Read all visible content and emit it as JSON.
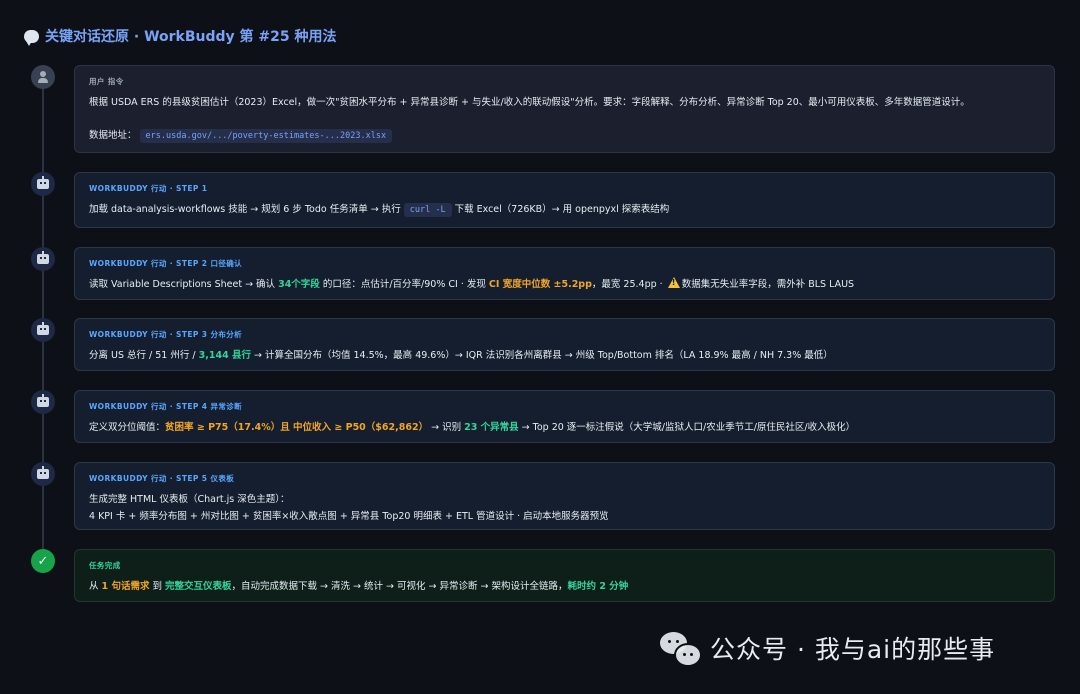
{
  "title": "关键对话还原 · WorkBuddy 第 #25 种用法",
  "cards": [
    {
      "label": "用户 指令",
      "line1": "根据 USDA ERS 的县级贫困估计（2023）Excel，做一次\"贫困水平分布 + 异常县诊断 + 与失业/收入的联动假设\"分析。要求：字段解释、分布分析、异常诊断 Top 20、最小可用仪表板、多年数据管道设计。",
      "line2_prefix": "数据地址：",
      "line2_code": "ers.usda.gov/.../poverty-estimates-...2023.xlsx"
    },
    {
      "label": "WORKBUDDY 行动 · STEP 1",
      "text_a": "加载 data-analysis-workflows 技能 → 规划 6 步 Todo 任务清单 → 执行 ",
      "code": "curl -L",
      "text_b": " 下载 Excel（726KB）→ 用 openpyxl 探索表结构"
    },
    {
      "label": "WORKBUDDY 行动 · STEP 2 口径确认",
      "text_a": "读取 Variable Descriptions Sheet → 确认 ",
      "hl_a": "34个字段",
      "text_b": " 的口径：点估计/百分率/90% CI · 发现 ",
      "hl_b": "CI 宽度中位数 ±5.2pp",
      "text_c": "，最宽 25.4pp · ",
      "text_d": "数据集无失业率字段，需外补 BLS LAUS"
    },
    {
      "label": "WORKBUDDY 行动 · STEP 3 分布分析",
      "text_a": "分离 US 总行 / 51 州行 / ",
      "hl_a": "3,144 县行",
      "text_b": " → 计算全国分布（均值 14.5%，最高 49.6%）→ IQR 法识别各州离群县 → 州级 Top/Bottom 排名（LA 18.9% 最高 / NH 7.3% 最低）"
    },
    {
      "label": "WORKBUDDY 行动 · STEP 4 异常诊断",
      "text_a": "定义双分位阈值：",
      "hl_a": "贫困率 ≥ P75（17.4%）且 中位收入 ≥ P50（$62,862）",
      "text_b": " → 识别 ",
      "hl_b": "23 个异常县",
      "text_c": " → Top 20 逐一标注假说（大学城/监狱人口/农业季节工/原住民社区/收入极化）"
    },
    {
      "label": "WORKBUDDY 行动 · STEP 5 仪表板",
      "line1": "生成完整 HTML 仪表板（Chart.js 深色主题）：",
      "line2": "4 KPI 卡 + 频率分布图 + 州对比图 + 贫困率×收入散点图 + 异常县 Top20 明细表 + ETL 管道设计 · 启动本地服务器预览"
    },
    {
      "label": "任务完成",
      "text_a": "从 ",
      "hl_a": "1 句话需求",
      "text_b": " 到 ",
      "hl_b": "完整交互仪表板",
      "text_c": "，自动完成数据下载 → 清洗 → 统计 → 可视化 → 异常诊断 → 架构设计全链路，",
      "hl_c": "耗时约 2 分钟"
    }
  ],
  "watermark": "公众号 · 我与ai的那些事",
  "icons": {
    "title": "speech-bubble-icon",
    "user": "user-avatar-icon",
    "step": "robot-icon",
    "done": "check-mark-icon",
    "warning": "warning-icon",
    "watermark": "wechat-icon"
  },
  "colors": {
    "background": "#0d1117",
    "title": "#7aa2f7",
    "step_label": "#58a6ff",
    "highlight_green": "#34d399",
    "highlight_orange": "#f0a428",
    "done": "#16a34a"
  }
}
